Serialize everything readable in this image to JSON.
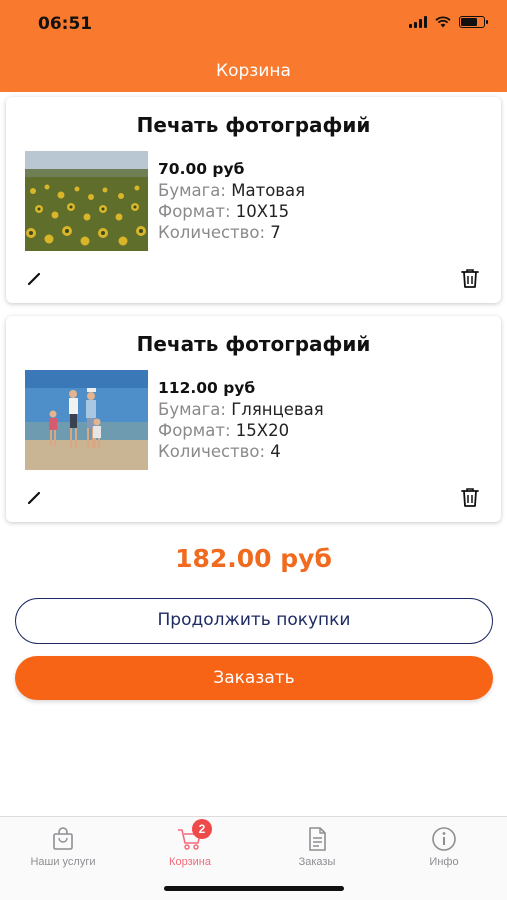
{
  "status_bar": {
    "time": "06:51"
  },
  "header": {
    "title": "Корзина"
  },
  "cart_items": [
    {
      "title": "Печать фотографий",
      "price": "70.00 руб",
      "paper_label": "Бумага:",
      "paper_value": "Матовая",
      "format_label": "Формат:",
      "format_value": "10X15",
      "qty_label": "Количество:",
      "qty_value": "7"
    },
    {
      "title": "Печать фотографий",
      "price": "112.00 руб",
      "paper_label": "Бумага:",
      "paper_value": "Глянцевая",
      "format_label": "Формат:",
      "format_value": "15X20",
      "qty_label": "Количество:",
      "qty_value": "4"
    }
  ],
  "total": "182.00 руб",
  "buttons": {
    "continue_label": "Продолжить покупки",
    "order_label": "Заказать"
  },
  "tabbar": {
    "tabs": [
      {
        "label": "Наши услуги",
        "icon": "bag-icon"
      },
      {
        "label": "Корзина",
        "icon": "cart-icon",
        "badge": "2"
      },
      {
        "label": "Заказы",
        "icon": "document-icon"
      },
      {
        "label": "Инфо",
        "icon": "info-icon"
      }
    ]
  },
  "colors": {
    "accent": "#f97a2e",
    "order_button": "#f86415",
    "total": "#f06a1f",
    "outline": "#1e2a63",
    "badge": "#ef4a4a",
    "active_tab": "#f26b7a"
  }
}
